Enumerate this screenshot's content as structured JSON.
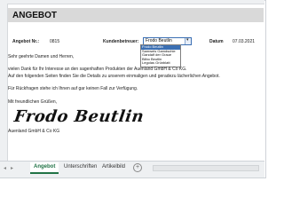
{
  "title": "ANGEBOT",
  "angebot_label": "Angebot Nr.:",
  "angebot_nr": "0815",
  "kunden_label": "Kundenbetreuer:",
  "kunden_value": "Frodo Beutlin",
  "dropdown_options": [
    "Frodo Beutlin",
    "Samweis Gamdschie",
    "Gandalf der Graue",
    "Bilbo Beutlin",
    "Legolas Grünblatt"
  ],
  "datum_label": "Datum",
  "datum": "07.03.2021",
  "greeting": "Sehr geehrte Damen und Herren,",
  "body1": "vielen Dank für Ihr Interesse an den sagenhaften Produkten der Auenland GmbH & Co KG.",
  "body2": "Auf den folgenden Seiten finden Sie die Details zu unserem einmaligen und geradezu lächerlichen Angebot.",
  "body3": "Für Rückfragen stehe ich Ihnen auf gar keinen Fall zur Verfügung.",
  "closing": "Mit freundlichen Grüßen,",
  "signature": "Frodo Beutlin",
  "company": "Auenland GmbH & Co KG",
  "tabs": [
    "Angebot",
    "Unterschriften",
    "Artikelbild"
  ],
  "nav_prev": "◂",
  "nav_next": "▸",
  "add_tab": "+"
}
